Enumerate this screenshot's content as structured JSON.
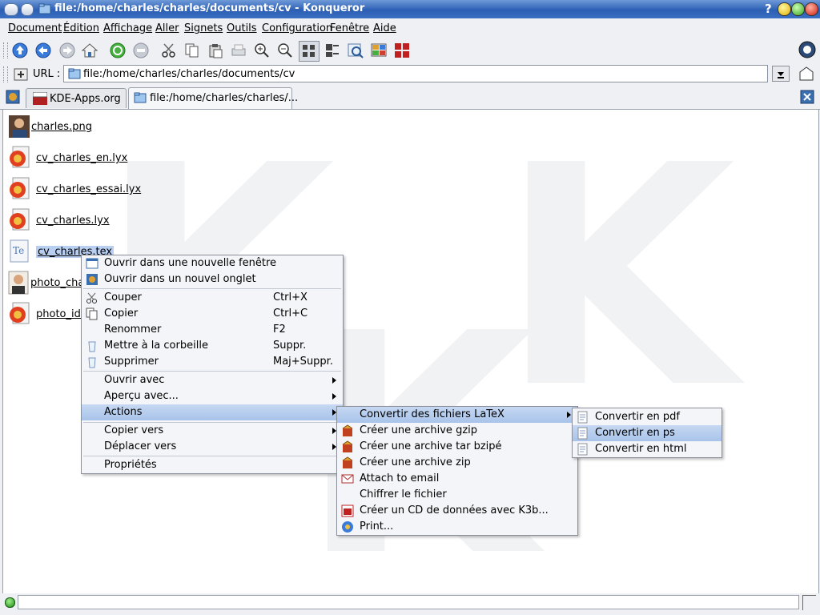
{
  "window": {
    "title": "file:/home/charles/charles/documents/cv - Konqueror",
    "help_glyph": "?"
  },
  "menubar": {
    "items": [
      "Document",
      "Édition",
      "Affichage",
      "Aller",
      "Signets",
      "Outils",
      "Configuration",
      "Fenêtre",
      "Aide"
    ]
  },
  "toolbar": {
    "icons": [
      "up-arrow-icon",
      "back-arrow-icon",
      "forward-arrow-icon",
      "home-icon",
      "reload-icon",
      "stop-icon",
      "cut-icon",
      "copy-icon",
      "paste-icon",
      "print-icon",
      "zoom-in-icon",
      "zoom-out-icon",
      "icon-view-icon",
      "detail-view-icon",
      "find-icon",
      "view-split-icon",
      "tiles-icon",
      "kde-gear-icon"
    ]
  },
  "location": {
    "label": "URL :",
    "value": "file:/home/charles/charles/documents/cv"
  },
  "tabs": [
    {
      "label": "KDE-Apps.org",
      "active": false
    },
    {
      "label": "file:/home/charles/charles/...",
      "active": true
    }
  ],
  "files": [
    {
      "name": "charles.png",
      "icon": "photo-icon"
    },
    {
      "name": "cv_charles_en.lyx",
      "icon": "lyx-icon"
    },
    {
      "name": "cv_charles_essai.lyx",
      "icon": "lyx-icon"
    },
    {
      "name": "cv_charles.lyx",
      "icon": "lyx-icon"
    },
    {
      "name": "cv_charles.tex",
      "icon": "tex-icon",
      "selected": true
    },
    {
      "name": "photo_char",
      "icon": "photo-icon"
    },
    {
      "name": "photo_ide",
      "icon": "lyx-icon"
    }
  ],
  "context_menu": {
    "items": [
      {
        "label": "Ouvrir dans une nouvelle fenêtre",
        "shortcut": "",
        "icon": "new-window-icon"
      },
      {
        "label": "Ouvrir dans un nouvel onglet",
        "shortcut": "",
        "icon": "new-tab-icon"
      },
      {
        "label": "Couper",
        "shortcut": "Ctrl+X",
        "icon": "cut-icon"
      },
      {
        "label": "Copier",
        "shortcut": "Ctrl+C",
        "icon": "copy-icon"
      },
      {
        "label": "Renommer",
        "shortcut": "F2",
        "icon": ""
      },
      {
        "label": "Mettre à la corbeille",
        "shortcut": "Suppr.",
        "icon": "trash-icon"
      },
      {
        "label": "Supprimer",
        "shortcut": "Maj+Suppr.",
        "icon": "delete-icon"
      },
      {
        "label": "Ouvrir avec",
        "shortcut": "",
        "icon": ""
      },
      {
        "label": "Aperçu avec...",
        "shortcut": "",
        "icon": ""
      },
      {
        "label": "Actions",
        "shortcut": "",
        "icon": ""
      },
      {
        "label": "Copier vers",
        "shortcut": "",
        "icon": ""
      },
      {
        "label": "Déplacer vers",
        "shortcut": "",
        "icon": ""
      },
      {
        "label": "Propriétés",
        "shortcut": "",
        "icon": ""
      }
    ]
  },
  "actions_menu": {
    "items": [
      {
        "label": "Convertir des fichiers LaTeX",
        "icon": ""
      },
      {
        "label": "Créer une archive gzip",
        "icon": "archive-icon"
      },
      {
        "label": "Créer une archive tar bzipé",
        "icon": "archive-icon"
      },
      {
        "label": "Créer une archive zip",
        "icon": "archive-icon"
      },
      {
        "label": "Attach to email",
        "icon": "email-icon"
      },
      {
        "label": "Chiffrer le fichier",
        "icon": ""
      },
      {
        "label": "Créer un CD de données avec K3b...",
        "icon": "k3b-icon"
      },
      {
        "label": "Print...",
        "icon": "print-icon"
      }
    ]
  },
  "latex_menu": {
    "items": [
      {
        "label": "Convertir en pdf",
        "icon": "document-icon"
      },
      {
        "label": "Convertir en ps",
        "icon": "document-icon"
      },
      {
        "label": "Convertir en html",
        "icon": "document-icon"
      }
    ]
  },
  "colors": {
    "titlebar": "#2c5fb4",
    "highlight": "#a8c3ea",
    "selection": "#b8cff2"
  }
}
